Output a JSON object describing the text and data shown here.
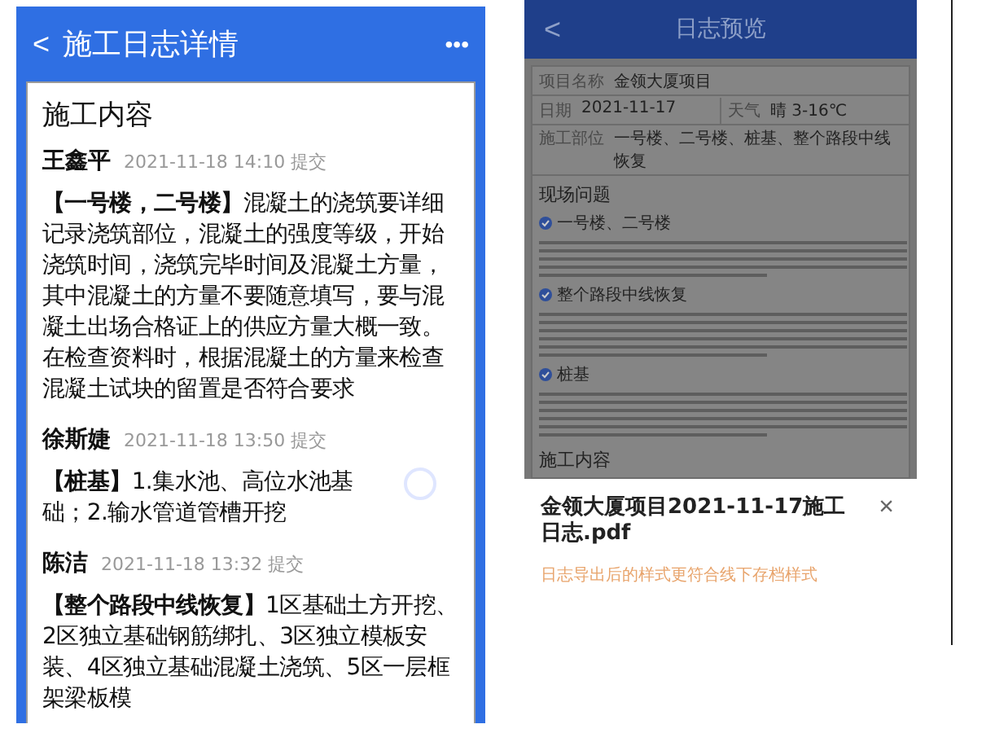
{
  "detail_screen": {
    "back": "<",
    "title": "施工日志详情",
    "more": "•••",
    "section_title": "施工内容",
    "entries": [
      {
        "author": "王鑫平",
        "time": "2021-11-18 14:10 提交",
        "tag": "【一号楼，二号楼】",
        "text": "混凝土的浇筑要详细记录浇筑部位，混凝土的强度等级，开始浇筑时间，浇筑完毕时间及混凝土方量，其中混凝土的方量不要随意填写，要与混凝土出场合格证上的供应方量大概一致。在检查资料时，根据混凝土的方量来检查混凝土试块的留置是否符合要求",
        "loading": false
      },
      {
        "author": "徐斯婕",
        "time": "2021-11-18 13:50 提交",
        "tag": "【桩基】",
        "text": "1.集水池、高位水池基础；2.输水管道管槽开挖",
        "loading": true
      },
      {
        "author": "陈洁",
        "time": "2021-11-18 13:32 提交",
        "tag": "【整个路段中线恢复】",
        "text": "1区基础土方开挖、2区独立基础钢筋绑扎、3区独立模板安装、4区独立基础混凝土浇筑、5区一层框架梁板模",
        "loading": false
      }
    ]
  },
  "preview_screen": {
    "back": "<",
    "title": "日志预览",
    "info_rows": [
      [
        {
          "label": "项目名称",
          "value": "金领大厦项目"
        }
      ],
      [
        {
          "label": "日期",
          "value": "2021-11-17"
        },
        {
          "label": "天气",
          "value": "晴 3-16℃"
        }
      ],
      [
        {
          "label": "施工部位",
          "value": "一号楼、二号楼、桩基、整个路段中线恢复"
        }
      ]
    ],
    "issues_title": "现场问题",
    "issues": [
      {
        "title": "一号楼、二号楼"
      },
      {
        "title": "整个路段中线恢复"
      },
      {
        "title": "桩基"
      }
    ],
    "content_title": "施工内容",
    "sheet": {
      "filename": "金领大厦项目2021-11-17施工日志.pdf",
      "close": "×",
      "hint": "日志导出后的样式更符合线下存档样式"
    }
  }
}
